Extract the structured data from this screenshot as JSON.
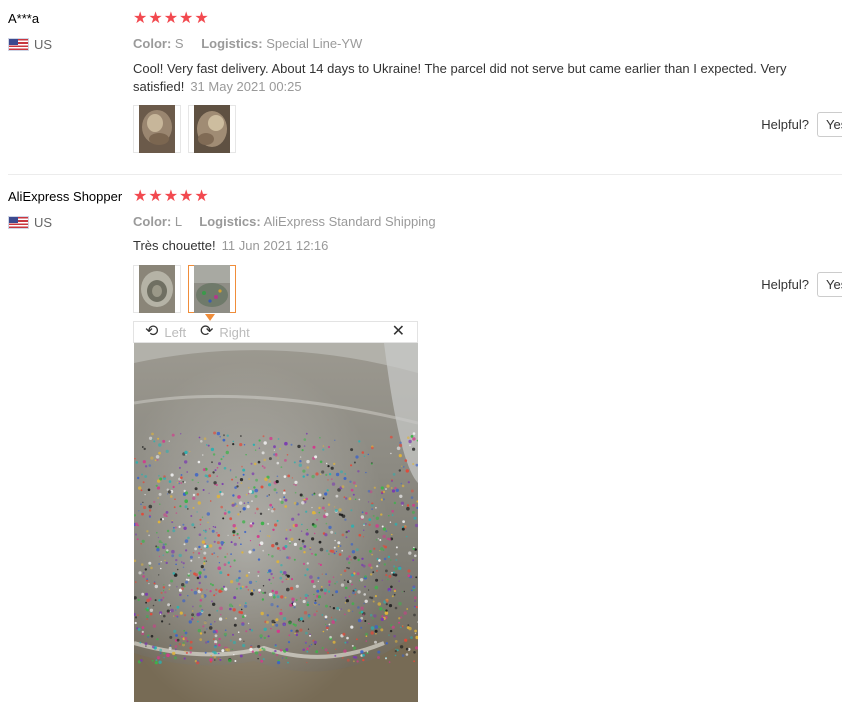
{
  "colors": {
    "star": "#f2494f",
    "active_border": "#f08d3a",
    "meta": "#9a9a9a"
  },
  "reviews": [
    {
      "user": "A***a",
      "country": "US",
      "flag_icon": "us-flag-icon",
      "rating": 5,
      "color_label": "Color:",
      "color_value": "S",
      "logistics_label": "Logistics:",
      "logistics_value": "Special Line-YW",
      "text": "Cool! Very fast delivery. About 14 days to Ukraine! The parcel did not serve but came earlier than I expected. Very satisfied!",
      "date": "31 May 2021 00:25",
      "helpful_label": "Helpful?",
      "yes_label": "Yes"
    },
    {
      "user": "AliExpress Shopper",
      "country": "US",
      "flag_icon": "us-flag-icon",
      "rating": 5,
      "color_label": "Color:",
      "color_value": "L",
      "logistics_label": "Logistics:",
      "logistics_value": "AliExpress Standard Shipping",
      "text": "Très chouette!",
      "date": "11 Jun 2021 12:16",
      "helpful_label": "Helpful?",
      "yes_label": "Yes"
    }
  ],
  "viewer": {
    "rotate_left_label": "Left",
    "rotate_right_label": "Right",
    "rotate_left_icon": "rotate-left-icon",
    "rotate_right_icon": "rotate-right-icon",
    "close_icon": "close-icon",
    "close_glyph": "✕"
  }
}
